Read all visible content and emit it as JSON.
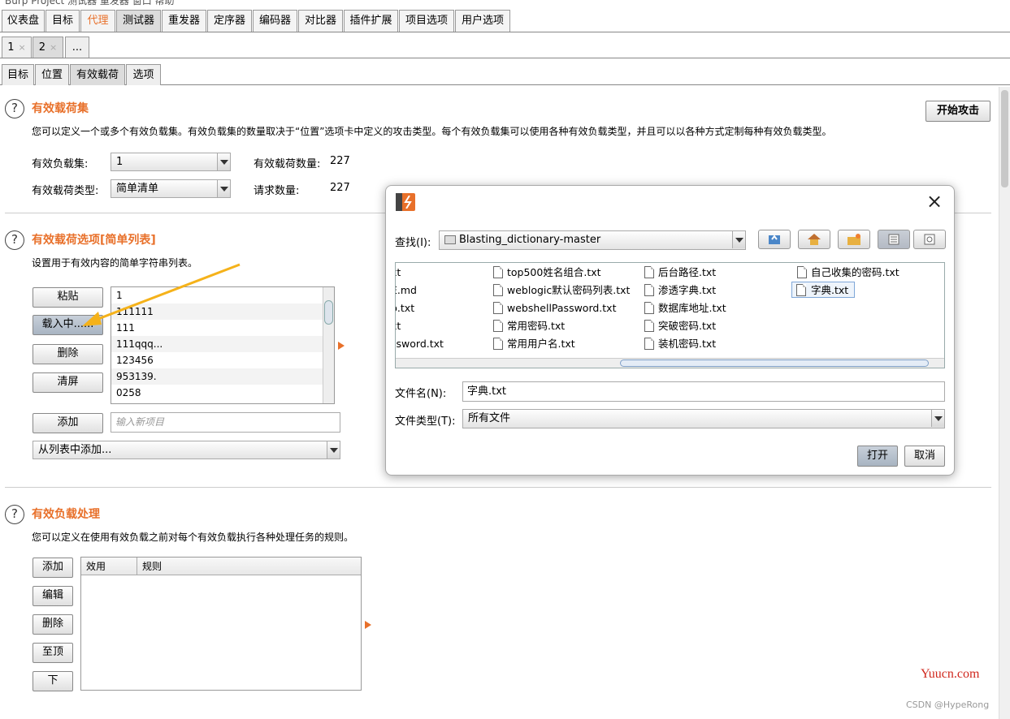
{
  "window": {
    "title_fragment": "Burp  Project  测试器  重发器  窗口  帮助"
  },
  "main_tabs": [
    "仪表盘",
    "目标",
    "代理",
    "测试器",
    "重发器",
    "定序器",
    "编码器",
    "对比器",
    "插件扩展",
    "项目选项",
    "用户选项"
  ],
  "instance_tabs": [
    {
      "label": "1",
      "close": "×"
    },
    {
      "label": "2",
      "close": "×"
    },
    {
      "label": "..."
    }
  ],
  "sub_tabs": [
    "目标",
    "位置",
    "有效载荷",
    "选项"
  ],
  "start_attack": "开始攻击",
  "payload_sets": {
    "title": "有效载荷集",
    "desc": "您可以定义一个或多个有效负载集。有效负载集的数量取决于“位置”选项卡中定义的攻击类型。每个有效负载集可以使用各种有效负载类型，并且可以以各种方式定制每种有效负载类型。",
    "set_label": "有效负载集:",
    "set_value": "1",
    "type_label": "有效载荷类型:",
    "type_value": "简单清单",
    "count_label": "有效载荷数量:",
    "count_value": "227",
    "req_label": "请求数量:",
    "req_value": "227"
  },
  "payload_options": {
    "title": "有效载荷选项[简单列表]",
    "desc": "设置用于有效内容的简单字符串列表。",
    "buttons": {
      "paste": "粘贴",
      "load": "载入中......",
      "remove": "删除",
      "clear": "清屏",
      "add": "添加"
    },
    "items": [
      "1",
      "111111",
      "111",
      "111qqq...",
      "123456",
      "953139.",
      "0258"
    ],
    "add_placeholder": "输入新项目",
    "add_from_list": "从列表中添加..."
  },
  "payload_processing": {
    "title": "有效负载处理",
    "desc": "您可以定义在使用有效负载之前对每个有效负载执行各种处理任务的规则。",
    "buttons": {
      "add": "添加",
      "edit": "编辑",
      "remove": "删除",
      "top": "至顶",
      "down": "下"
    },
    "columns": [
      "效用",
      "规则"
    ]
  },
  "dialog": {
    "lookin_label": "查找(I):",
    "lookin_value": "Blasting_dictionary-master",
    "files_col1": [
      "xt",
      "E.md",
      "p.txt",
      "xt",
      "ssword.txt"
    ],
    "files_col2": [
      "top500姓名组合.txt",
      "weblogic默认密码列表.txt",
      "webshellPassword.txt",
      "常用密码.txt",
      "常用用户名.txt"
    ],
    "files_col3": [
      "后台路径.txt",
      "渗透字典.txt",
      "数据库地址.txt",
      "突破密码.txt",
      "装机密码.txt"
    ],
    "files_col4": [
      "自己收集的密码.txt",
      "字典.txt"
    ],
    "filename_label": "文件名(N):",
    "filename_value": "字典.txt",
    "filetype_label": "文件类型(T):",
    "filetype_value": "所有文件",
    "open": "打开",
    "cancel": "取消",
    "close_icon": "×"
  },
  "watermark": {
    "site": "Yuucn.com",
    "author": "CSDN @HypeRong"
  },
  "colors": {
    "accent": "#e8702a",
    "arrow": "#f5b21a"
  }
}
